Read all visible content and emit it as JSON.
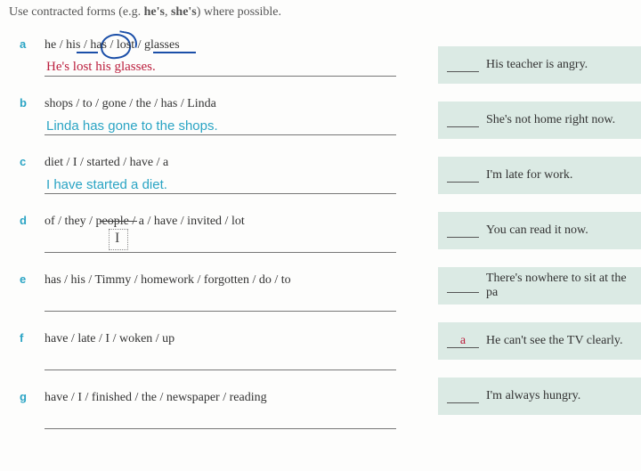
{
  "instruction_pre": "Use contracted forms (e.g. ",
  "instruction_bold1": "he's",
  "instruction_mid": ", ",
  "instruction_bold2": "she's",
  "instruction_post": ") where possible.",
  "exercises": {
    "a": {
      "letter": "a",
      "prompt": "he / his / has / lost / glasses",
      "answer": "He's lost his glasses."
    },
    "b": {
      "letter": "b",
      "prompt": "shops / to / gone / the / has / Linda",
      "answer": "Linda has gone to the shops."
    },
    "c": {
      "letter": "c",
      "prompt": "diet / I / started / have / a",
      "answer": "I have started a diet."
    },
    "d": {
      "letter": "d",
      "prompt": "of / they / people / a / have / invited / lot",
      "answer": ""
    },
    "e": {
      "letter": "e",
      "prompt": "has / his / Timmy / homework / forgotten / do / to",
      "answer": ""
    },
    "f": {
      "letter": "f",
      "prompt": "have / late  / I / woken / up",
      "answer": ""
    },
    "g": {
      "letter": "g",
      "prompt": "have / I / finished / the / newspaper / reading",
      "answer": ""
    }
  },
  "matches": {
    "m1": {
      "fill": "",
      "text": "His teacher is angry."
    },
    "m2": {
      "fill": "",
      "text": "She's not home right now."
    },
    "m3": {
      "fill": "",
      "text": "I'm late for work."
    },
    "m4": {
      "fill": "",
      "text": "You can read it now."
    },
    "m5": {
      "fill": "",
      "text": "There's nowhere to sit at the pa"
    },
    "m6": {
      "fill": "a",
      "text": "He can't see the TV clearly."
    },
    "m7": {
      "fill": "",
      "text": "I'm always hungry."
    }
  }
}
